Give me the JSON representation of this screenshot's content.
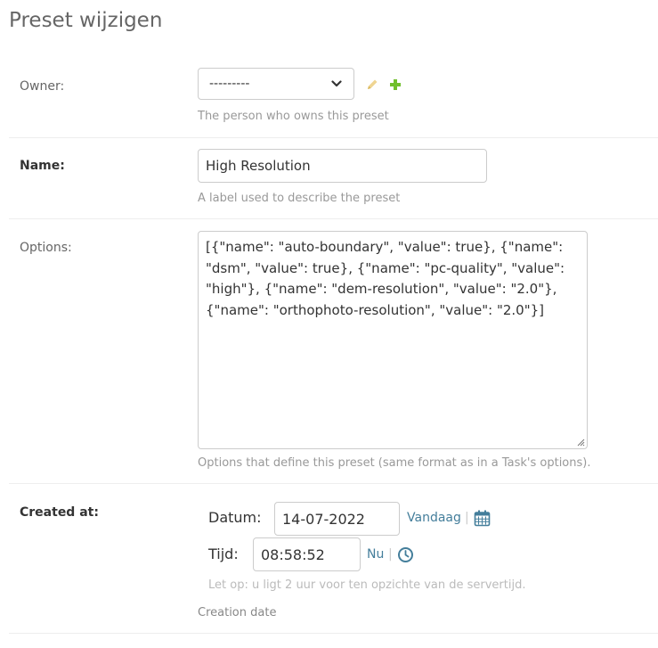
{
  "page": {
    "title": "Preset wijzigen"
  },
  "owner": {
    "label": "Owner:",
    "selected": "---------",
    "help": "The person who owns this preset"
  },
  "name": {
    "label": "Name:",
    "value": "High Resolution",
    "help": "A label used to describe the preset"
  },
  "options": {
    "label": "Options:",
    "value": "[{\"name\": \"auto-boundary\", \"value\": true}, {\"name\": \"dsm\", \"value\": true}, {\"name\": \"pc-quality\", \"value\": \"high\"}, {\"name\": \"dem-resolution\", \"value\": \"2.0\"}, {\"name\": \"orthophoto-resolution\", \"value\": \"2.0\"}]",
    "help": "Options that define this preset (same format as in a Task's options)."
  },
  "created_at": {
    "label": "Created at:",
    "date_label": "Datum:",
    "date_value": "14-07-2022",
    "today_link": "Vandaag",
    "separator": "|",
    "time_label": "Tijd:",
    "time_value": "08:58:52",
    "now_link": "Nu",
    "timezone_warning": "Let op: u ligt 2 uur voor ten opzichte van de servertijd.",
    "help": "Creation date"
  },
  "icons": {
    "edit": "pencil-icon",
    "add": "plus-icon",
    "calendar": "calendar-icon",
    "clock": "clock-icon",
    "dropdown": "chevron-down-icon"
  },
  "colors": {
    "link": "#447e9b",
    "edit_icon": "#efd593",
    "add_icon": "#70bf2b",
    "border": "#cccccc",
    "help_text": "#999999"
  }
}
